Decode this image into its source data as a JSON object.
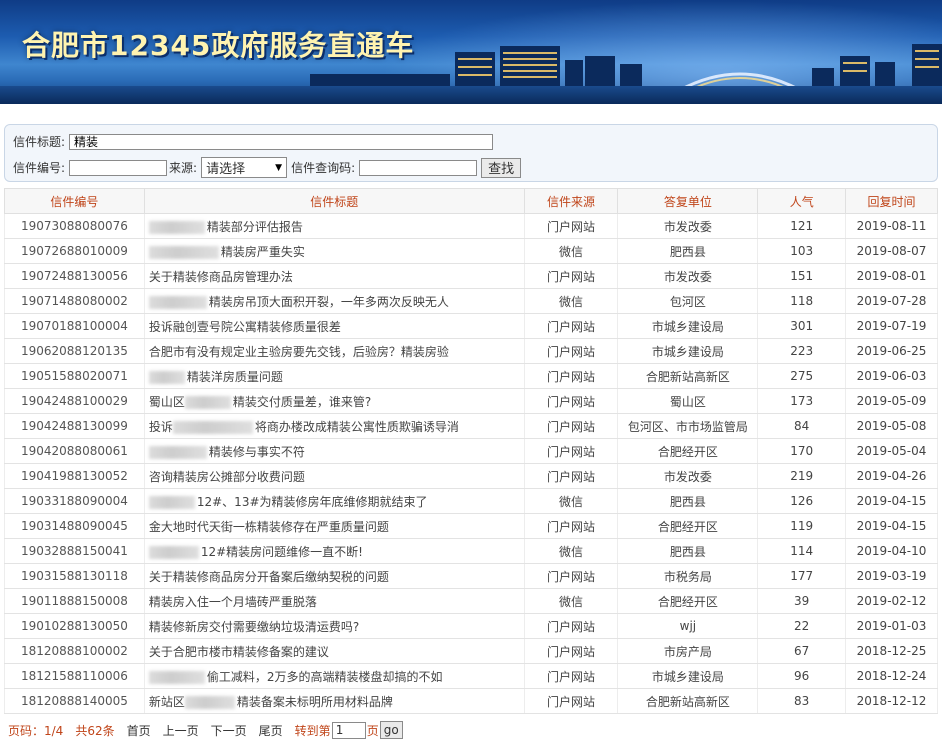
{
  "banner": {
    "title": "合肥市12345政府服务直通车"
  },
  "search": {
    "title_label": "信件标题:",
    "title_value": "精装",
    "number_label": "信件编号:",
    "number_value": "",
    "source_label": "来源:",
    "source_selected": "请选择",
    "query_code_label": "信件查询码:",
    "query_code_value": "",
    "find_button": "查找"
  },
  "table": {
    "headers": [
      "信件编号",
      "信件标题",
      "信件来源",
      "答复单位",
      "人气",
      "回复时间"
    ],
    "rows": [
      {
        "no": "19073088080076",
        "title": "精装部分评估报告",
        "blur": 56,
        "source": "门户网站",
        "unit": "市发改委",
        "pop": "121",
        "date": "2019-08-11"
      },
      {
        "no": "19072688010009",
        "title": "精装房严重失实",
        "blur": 70,
        "source": "微信",
        "unit": "肥西县",
        "pop": "103",
        "date": "2019-08-07"
      },
      {
        "no": "19072488130056",
        "title": "关于精装修商品房管理办法",
        "blur": 0,
        "source": "门户网站",
        "unit": "市发改委",
        "pop": "151",
        "date": "2019-08-01"
      },
      {
        "no": "19071488080002",
        "title": "精装房吊顶大面积开裂，一年多两次反映无人",
        "blur": 58,
        "source": "微信",
        "unit": "包河区",
        "pop": "118",
        "date": "2019-07-28"
      },
      {
        "no": "19070188100004",
        "title": "投诉融创壹号院公寓精装修质量很差",
        "blur": 0,
        "source": "门户网站",
        "unit": "市城乡建设局",
        "pop": "301",
        "date": "2019-07-19"
      },
      {
        "no": "19062088120135",
        "title": "合肥市有没有规定业主验房要先交钱，后验房？精装房验",
        "blur": 0,
        "source": "门户网站",
        "unit": "市城乡建设局",
        "pop": "223",
        "date": "2019-06-25"
      },
      {
        "no": "19051588020071",
        "title": "精装洋房质量问题",
        "blur": 36,
        "source": "门户网站",
        "unit": "合肥新站高新区",
        "pop": "275",
        "date": "2019-06-03"
      },
      {
        "no": "19042488100029",
        "title": "蜀山区",
        "title2": "精装交付质量差，谁来管?",
        "blur": 46,
        "source": "门户网站",
        "unit": "蜀山区",
        "pop": "173",
        "date": "2019-05-09"
      },
      {
        "no": "19042488130099",
        "title": "投诉",
        "title2": "将商办楼改成精装公寓性质欺骗诱导消",
        "blur": 80,
        "source": "门户网站",
        "unit": "包河区、市市场监管局",
        "pop": "84",
        "date": "2019-05-08"
      },
      {
        "no": "19042088080061",
        "title": "精装修与事实不符",
        "blur": 58,
        "source": "门户网站",
        "unit": "合肥经开区",
        "pop": "170",
        "date": "2019-05-04"
      },
      {
        "no": "19041988130052",
        "title": "咨询精装房公摊部分收费问题",
        "blur": 0,
        "source": "门户网站",
        "unit": "市发改委",
        "pop": "219",
        "date": "2019-04-26"
      },
      {
        "no": "19033188090004",
        "title": "12#、13#为精装修房年底维修期就结束了",
        "blur": 46,
        "source": "微信",
        "unit": "肥西县",
        "pop": "126",
        "date": "2019-04-15"
      },
      {
        "no": "19031488090045",
        "title": "金大地时代天街一栋精装修存在严重质量问题",
        "blur": 0,
        "source": "门户网站",
        "unit": "合肥经开区",
        "pop": "119",
        "date": "2019-04-15"
      },
      {
        "no": "19032888150041",
        "title": "12#精装房问题维修一直不断!",
        "blur": 50,
        "source": "微信",
        "unit": "肥西县",
        "pop": "114",
        "date": "2019-04-10"
      },
      {
        "no": "19031588130118",
        "title": "关于精装修商品房分开备案后缴纳契税的问题",
        "blur": 0,
        "source": "门户网站",
        "unit": "市税务局",
        "pop": "177",
        "date": "2019-03-19"
      },
      {
        "no": "19011888150008",
        "title": "精装房入住一个月墙砖严重脱落",
        "blur": 0,
        "source": "微信",
        "unit": "合肥经开区",
        "pop": "39",
        "date": "2019-02-12"
      },
      {
        "no": "19010288130050",
        "title": "精装修新房交付需要缴纳垃圾清运费吗?",
        "blur": 0,
        "source": "门户网站",
        "unit": "wjj",
        "pop": "22",
        "date": "2019-01-03"
      },
      {
        "no": "18120888100002",
        "title": "关于合肥市楼市精装修备案的建议",
        "blur": 0,
        "source": "门户网站",
        "unit": "市房产局",
        "pop": "67",
        "date": "2018-12-25"
      },
      {
        "no": "18121588110006",
        "title": "偷工减料，2万多的高端精装楼盘却搞的不如",
        "blur": 56,
        "source": "门户网站",
        "unit": "市城乡建设局",
        "pop": "96",
        "date": "2018-12-24"
      },
      {
        "no": "18120888140005",
        "title": "新站区",
        "title2": "精装备案未标明所用材料品牌",
        "blur": 50,
        "source": "门户网站",
        "unit": "合肥新站高新区",
        "pop": "83",
        "date": "2018-12-12"
      }
    ]
  },
  "pager": {
    "page_info": "页码：1/4",
    "total": "共62条",
    "first": "首页",
    "prev": "上一页",
    "next": "下一页",
    "last": "尾页",
    "jump_prefix": "转到第",
    "page_value": "1",
    "jump_suffix": "页",
    "go": "go"
  },
  "colors": {
    "header_text": "#c0451a",
    "banner_title": "#fff3b0",
    "banner_blue": "#1d5cb0"
  }
}
